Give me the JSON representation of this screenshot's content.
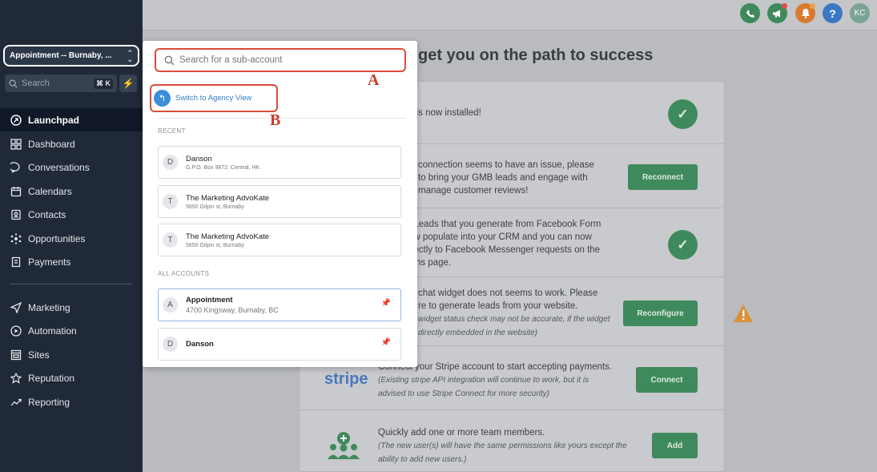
{
  "sidebar": {
    "account_switcher": "Appointment -- Burnaby, ...",
    "search_label": "Search",
    "search_shortcut": "⌘ K",
    "nav_primary": [
      {
        "label": "Launchpad",
        "icon": "rocket-icon",
        "active": true
      },
      {
        "label": "Dashboard",
        "icon": "grid-icon"
      },
      {
        "label": "Conversations",
        "icon": "chat-icon"
      },
      {
        "label": "Calendars",
        "icon": "calendar-icon"
      },
      {
        "label": "Contacts",
        "icon": "contact-card-icon"
      },
      {
        "label": "Opportunities",
        "icon": "network-icon"
      },
      {
        "label": "Payments",
        "icon": "receipt-icon"
      }
    ],
    "nav_secondary": [
      {
        "label": "Marketing",
        "icon": "send-icon"
      },
      {
        "label": "Automation",
        "icon": "play-circle-icon"
      },
      {
        "label": "Sites",
        "icon": "browser-icon"
      },
      {
        "label": "Reputation",
        "icon": "star-icon"
      },
      {
        "label": "Reporting",
        "icon": "trend-icon"
      }
    ]
  },
  "topbar": {
    "avatar_initials": "KC",
    "icons": [
      "phone-icon",
      "megaphone-icon",
      "bell-icon",
      "help-icon"
    ],
    "colors": {
      "phone": "#3f8a5c",
      "megaphone": "#3f8a5c",
      "bell": "#d97a30",
      "help": "#3b78c4",
      "avatar": "#7aa394"
    }
  },
  "main": {
    "title": "get you on the path to success",
    "rows": [
      {
        "text": "p is now installed!",
        "status": "check"
      },
      {
        "text_lines": [
          "connection seems to have an issue, please",
          "to bring your GMB leads and engage with",
          "manage customer reviews!"
        ],
        "button": "Reconnect"
      },
      {
        "text_lines": [
          "! Leads that you generate from Facebook Form",
          "ow populate into your CRM and you can now",
          "irectly to Facebook Messenger requests on the",
          "ions page."
        ],
        "status": "check"
      },
      {
        "text_lines": [
          "chat widget does not seems to work. Please",
          "re to generate leads from your website."
        ],
        "note_lines": [
          "widget status check may not be accurate, if the widget",
          "directly embedded in the website)"
        ],
        "button": "Reconfigure"
      },
      {
        "logo": "stripe",
        "text": "Connect your Stripe account to start accepting payments.",
        "note_lines": [
          "(Existing stripe API integration will continue to work, but it is",
          "advised to use Stripe Connect for more security)"
        ],
        "button": "Connect"
      },
      {
        "text": "Quickly add one or more team members.",
        "note_lines": [
          "(The new user(s) will have the same permissions like yours except the",
          "ability to add new users.)"
        ],
        "button": "Add"
      }
    ]
  },
  "popup": {
    "search_placeholder": "Search for a sub-account",
    "switch_label": "Switch to Agency View",
    "recent_label": "RECENT",
    "recent": [
      {
        "initial": "D",
        "name": "Danson",
        "address": "G.P.O. Box 9872, Central, HK"
      },
      {
        "initial": "T",
        "name": "The Marketing AdvoKate",
        "address": "5650 Gilpin st, Burnaby"
      },
      {
        "initial": "T",
        "name": "The Marketing AdvoKate",
        "address": "5650 Gilpin st, Burnaby"
      }
    ],
    "all_label": "ALL ACCOUNTS",
    "all": [
      {
        "initial": "A",
        "name": "Appointment",
        "address": "4700 Kingsway, Burnaby, BC"
      },
      {
        "initial": "D",
        "name": "Danson",
        "address": ""
      }
    ]
  },
  "annotations": {
    "a": "A",
    "b": "B"
  }
}
